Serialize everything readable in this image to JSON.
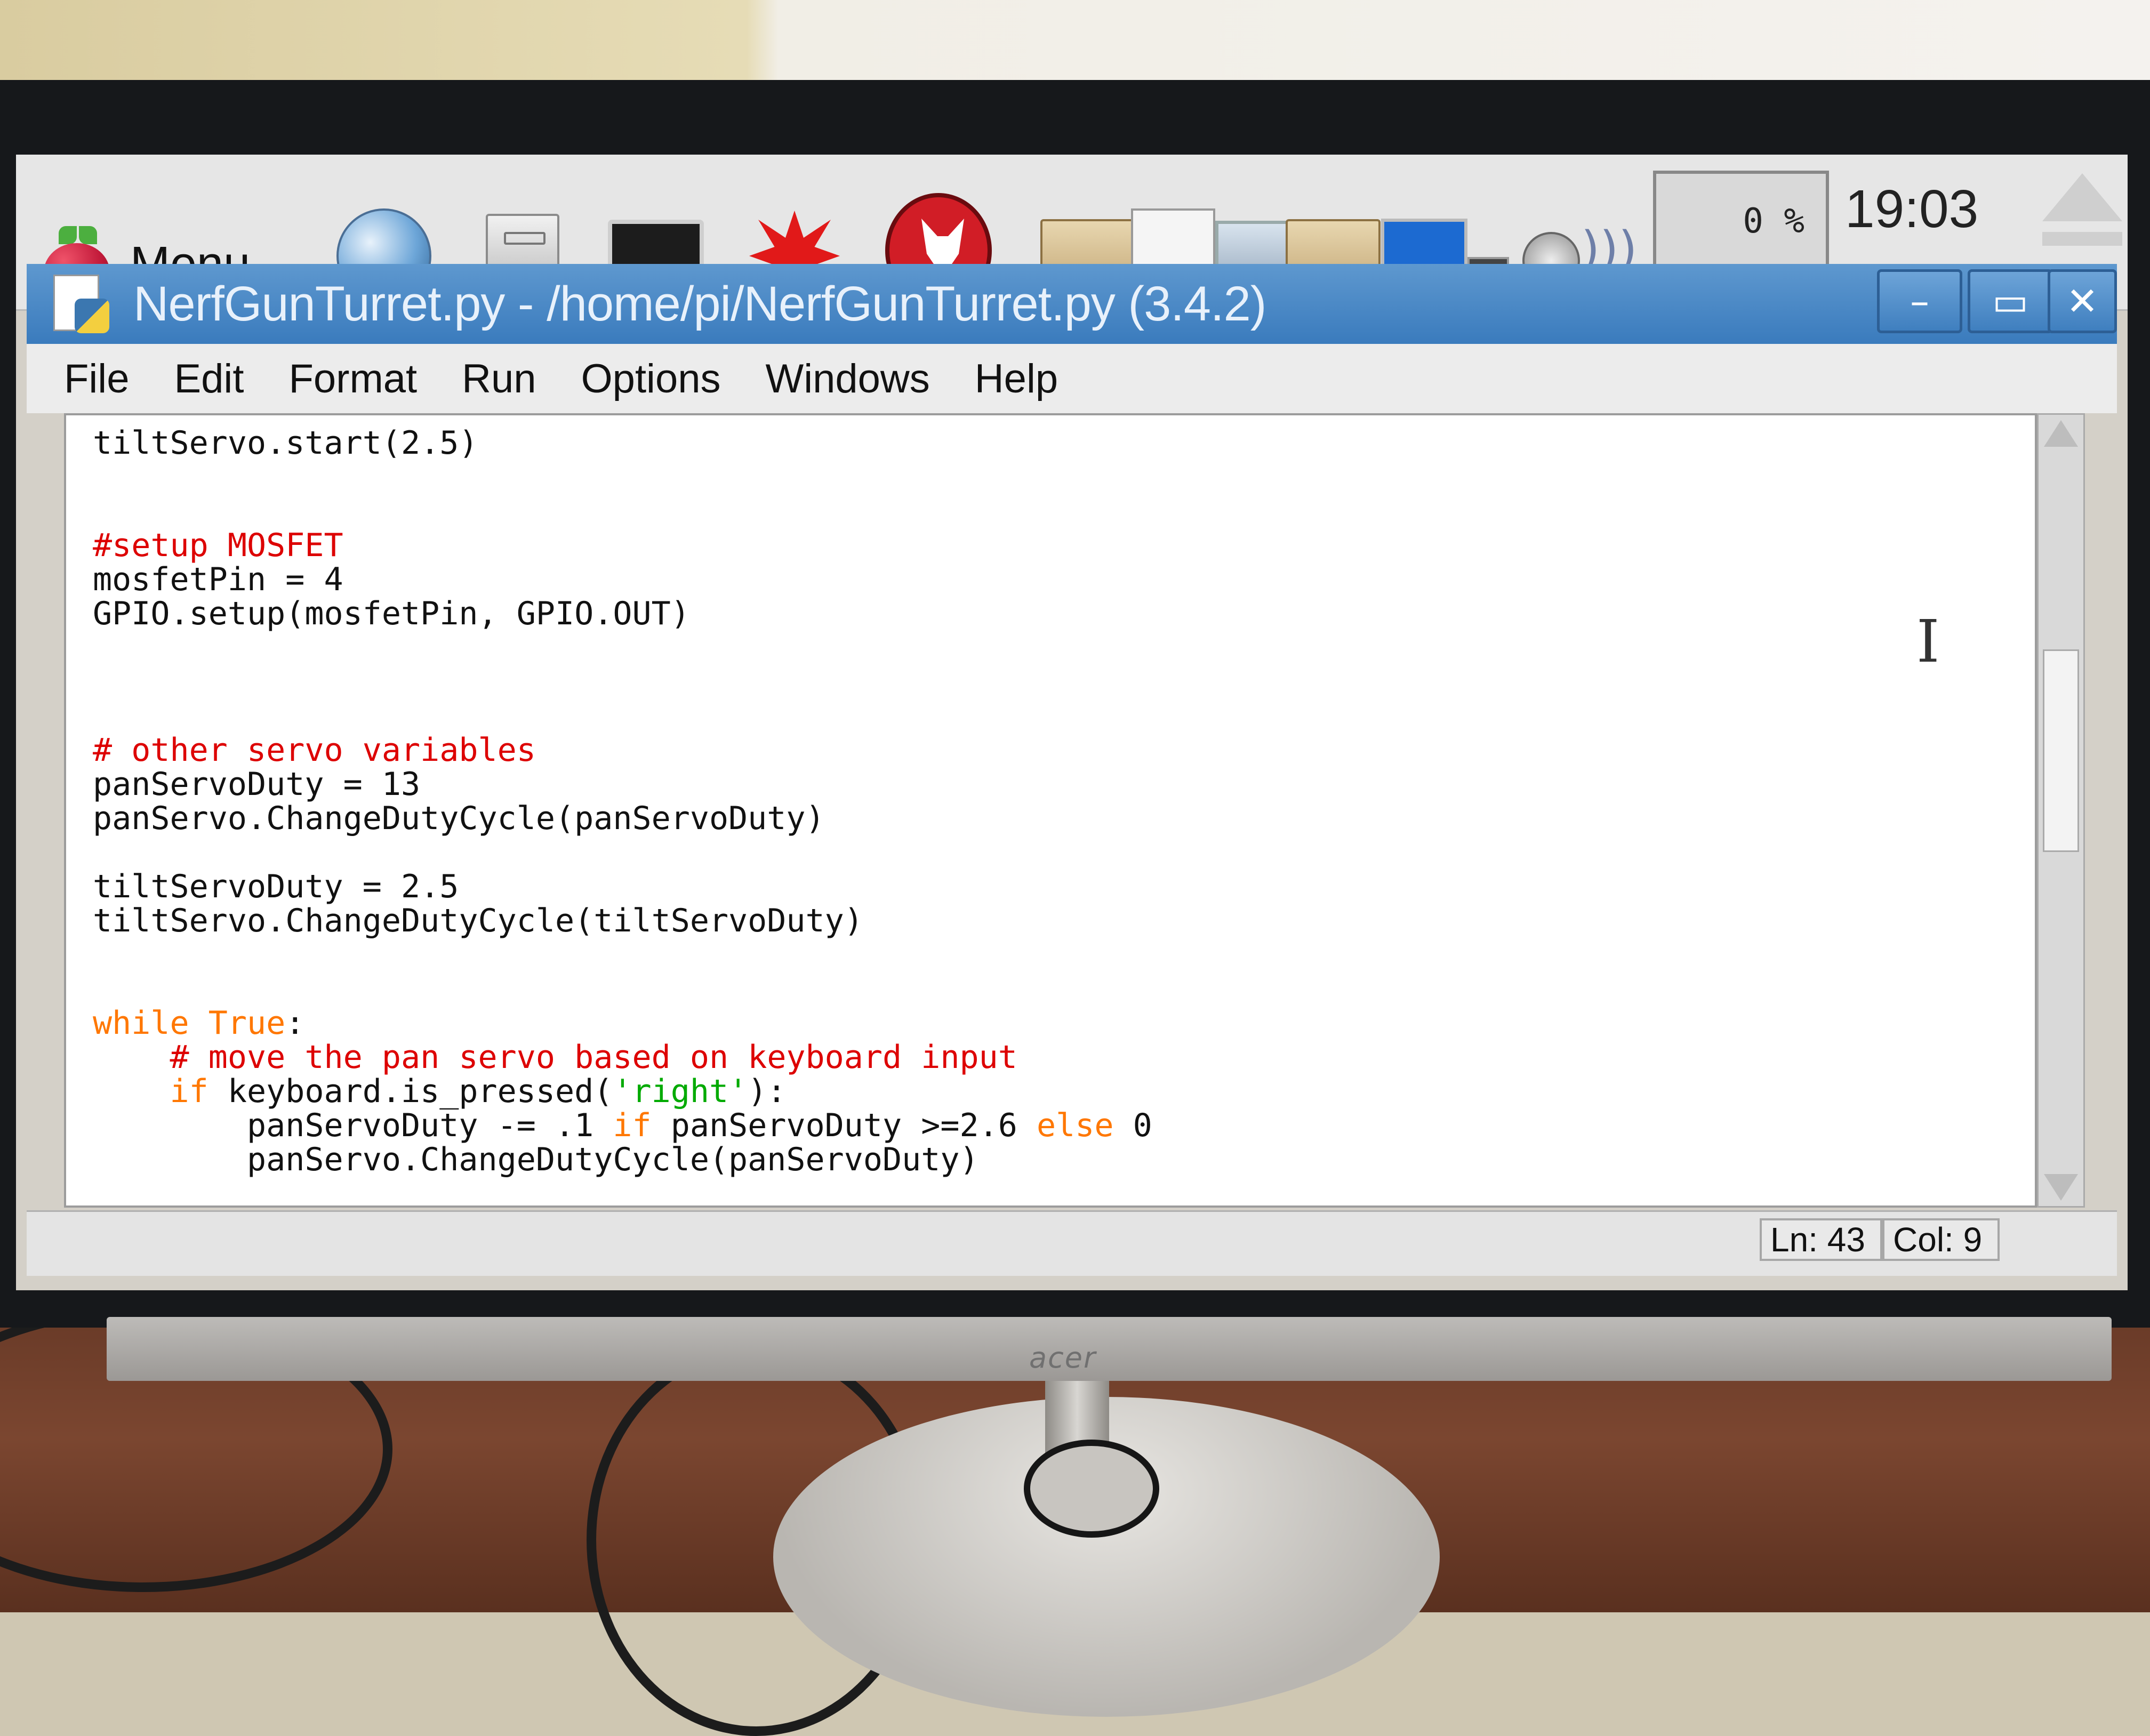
{
  "taskbar": {
    "menu_label": "Menu",
    "cpu_usage": "0 %",
    "clock": "19:03",
    "launchers": [
      "web-browser-icon",
      "file-manager-icon",
      "terminal-icon",
      "mathematica-icon",
      "wolfram-icon"
    ],
    "tray": [
      "folder-icon",
      "python-file-icon",
      "computer-icon",
      "network-icon",
      "volume-icon"
    ]
  },
  "window": {
    "title": "NerfGunTurret.py - /home/pi/NerfGunTurret.py (3.4.2)",
    "minimize_label": "–",
    "maximize_label": "▭",
    "close_label": "✕"
  },
  "menubar": {
    "items": [
      "File",
      "Edit",
      "Format",
      "Run",
      "Options",
      "Windows",
      "Help"
    ]
  },
  "editor": {
    "lines": [
      [
        {
          "t": "tiltServo.start(2.5)",
          "c": "plain"
        }
      ],
      [
        {
          "t": "",
          "c": "plain"
        }
      ],
      [
        {
          "t": "",
          "c": "plain"
        }
      ],
      [
        {
          "t": "#setup MOSFET",
          "c": "comment"
        }
      ],
      [
        {
          "t": "mosfetPin = 4",
          "c": "plain"
        }
      ],
      [
        {
          "t": "GPIO.setup(mosfetPin, GPIO.OUT)",
          "c": "plain"
        }
      ],
      [
        {
          "t": "",
          "c": "plain"
        }
      ],
      [
        {
          "t": "",
          "c": "plain"
        }
      ],
      [
        {
          "t": "",
          "c": "plain"
        }
      ],
      [
        {
          "t": "# other servo variables",
          "c": "comment"
        }
      ],
      [
        {
          "t": "panServoDuty = 13",
          "c": "plain"
        }
      ],
      [
        {
          "t": "panServo.ChangeDutyCycle(panServoDuty)",
          "c": "plain"
        }
      ],
      [
        {
          "t": "",
          "c": "plain"
        }
      ],
      [
        {
          "t": "tiltServoDuty = 2.5",
          "c": "plain"
        }
      ],
      [
        {
          "t": "tiltServo.ChangeDutyCycle(tiltServoDuty)",
          "c": "plain"
        }
      ],
      [
        {
          "t": "",
          "c": "plain"
        }
      ],
      [
        {
          "t": "",
          "c": "plain"
        }
      ],
      [
        {
          "t": "while",
          "c": "keyword"
        },
        {
          "t": " ",
          "c": "plain"
        },
        {
          "t": "True",
          "c": "keyword"
        },
        {
          "t": ":",
          "c": "plain"
        }
      ],
      [
        {
          "t": "    ",
          "c": "plain"
        },
        {
          "t": "# move the pan servo based on keyboard input",
          "c": "comment"
        }
      ],
      [
        {
          "t": "    ",
          "c": "plain"
        },
        {
          "t": "if",
          "c": "keyword"
        },
        {
          "t": " keyboard.is_pressed(",
          "c": "plain"
        },
        {
          "t": "'right'",
          "c": "string"
        },
        {
          "t": "):",
          "c": "plain"
        }
      ],
      [
        {
          "t": "        panServoDuty -= .1 ",
          "c": "plain"
        },
        {
          "t": "if",
          "c": "keyword"
        },
        {
          "t": " panServoDuty >=2.6 ",
          "c": "plain"
        },
        {
          "t": "else",
          "c": "keyword"
        },
        {
          "t": " 0",
          "c": "plain"
        }
      ],
      [
        {
          "t": "        panServo.ChangeDutyCycle(panServoDuty)",
          "c": "plain"
        }
      ]
    ]
  },
  "status": {
    "line": "Ln: 43",
    "col": "Col: 9"
  },
  "monitor": {
    "brand": "acer"
  }
}
